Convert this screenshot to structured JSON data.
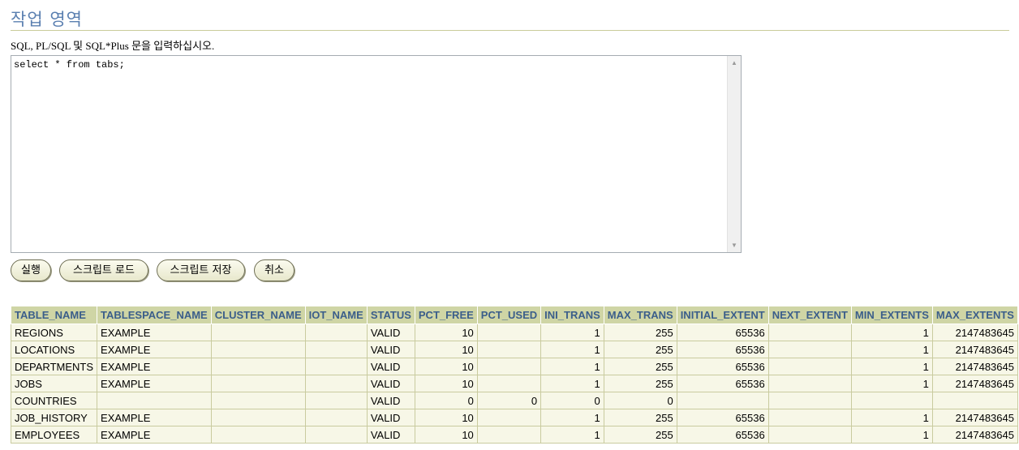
{
  "page": {
    "title": "작업 영역",
    "instruction": "SQL, PL/SQL 및 SQL*Plus 문을 입력하십시오."
  },
  "editor": {
    "value": "select * from tabs;"
  },
  "buttons": {
    "execute": "실행",
    "load_script": "스크립트 로드",
    "save_script": "스크립트 저장",
    "cancel": "취소"
  },
  "colors": {
    "title": "#5a7fb0",
    "header_bg": "#cfd5a5",
    "header_text": "#3b5e8a",
    "cell_bg": "#f7f7e7"
  },
  "icons": {
    "scroll_up": "scroll-up-arrow-icon",
    "scroll_down": "scroll-down-arrow-icon"
  },
  "results": {
    "columns": [
      "TABLE_NAME",
      "TABLESPACE_NAME",
      "CLUSTER_NAME",
      "IOT_NAME",
      "STATUS",
      "PCT_FREE",
      "PCT_USED",
      "INI_TRANS",
      "MAX_TRANS",
      "INITIAL_EXTENT",
      "NEXT_EXTENT",
      "MIN_EXTENTS",
      "MAX_EXTENTS"
    ],
    "rows": [
      [
        "REGIONS",
        "EXAMPLE",
        "",
        "",
        "VALID",
        "10",
        "",
        "1",
        "255",
        "65536",
        "",
        "1",
        "2147483645"
      ],
      [
        "LOCATIONS",
        "EXAMPLE",
        "",
        "",
        "VALID",
        "10",
        "",
        "1",
        "255",
        "65536",
        "",
        "1",
        "2147483645"
      ],
      [
        "DEPARTMENTS",
        "EXAMPLE",
        "",
        "",
        "VALID",
        "10",
        "",
        "1",
        "255",
        "65536",
        "",
        "1",
        "2147483645"
      ],
      [
        "JOBS",
        "EXAMPLE",
        "",
        "",
        "VALID",
        "10",
        "",
        "1",
        "255",
        "65536",
        "",
        "1",
        "2147483645"
      ],
      [
        "COUNTRIES",
        "",
        "",
        "",
        "VALID",
        "0",
        "0",
        "0",
        "0",
        "",
        "",
        "",
        ""
      ],
      [
        "JOB_HISTORY",
        "EXAMPLE",
        "",
        "",
        "VALID",
        "10",
        "",
        "1",
        "255",
        "65536",
        "",
        "1",
        "2147483645"
      ],
      [
        "EMPLOYEES",
        "EXAMPLE",
        "",
        "",
        "VALID",
        "10",
        "",
        "1",
        "255",
        "65536",
        "",
        "1",
        "2147483645"
      ]
    ]
  }
}
